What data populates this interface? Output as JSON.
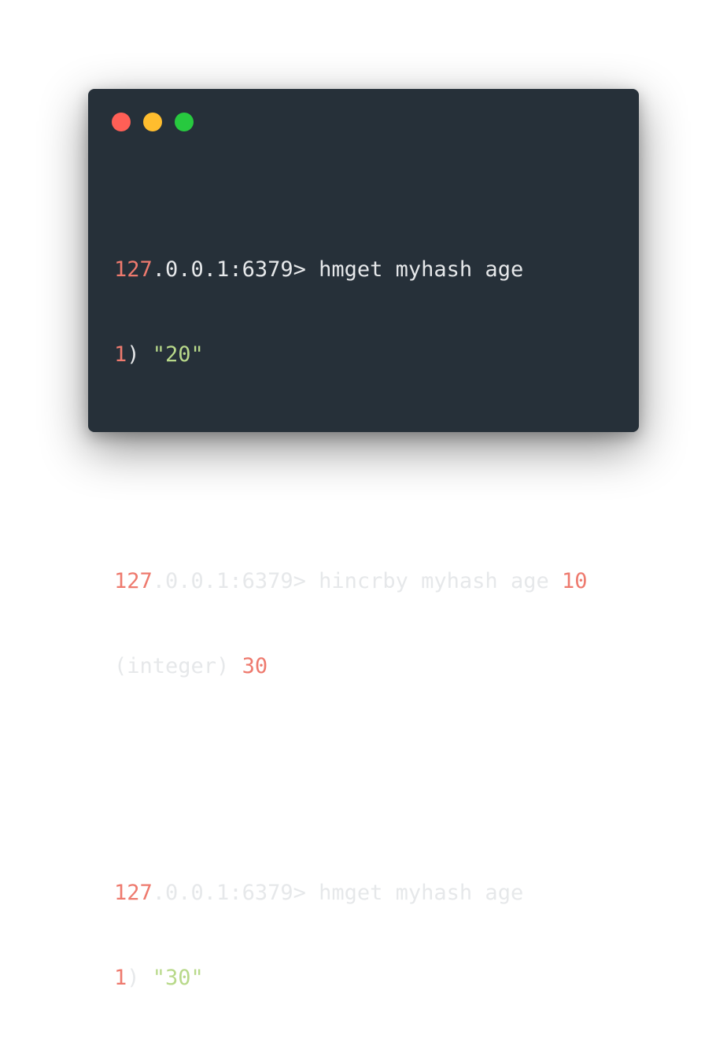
{
  "window": {
    "title_dots": [
      "close",
      "minimize",
      "maximize"
    ]
  },
  "colors": {
    "background": "#263039",
    "text": "#e6e8ea",
    "number": "#ee7a6e",
    "string": "#b8d98a",
    "dot_close": "#ff5f56",
    "dot_minimize": "#ffbd2e",
    "dot_maximize": "#27c93f"
  },
  "terminal": {
    "blocks": [
      {
        "prompt_num": "127",
        "prompt_rest": ".0.0.1:6379>",
        "command": " hmget myhash age",
        "command_arg_num": "",
        "result_prefix_num": "1",
        "result_prefix_rest": ")",
        "result_value": " \"20\""
      },
      {
        "prompt_num": "127",
        "prompt_rest": ".0.0.1:6379>",
        "command": " hincrby myhash age ",
        "command_arg_num": "10",
        "result_prefix_num": "",
        "result_prefix_rest": "(integer) ",
        "result_value": "30"
      },
      {
        "prompt_num": "127",
        "prompt_rest": ".0.0.1:6379>",
        "command": " hmget myhash age",
        "command_arg_num": "",
        "result_prefix_num": "1",
        "result_prefix_rest": ")",
        "result_value": " \"30\""
      }
    ]
  }
}
